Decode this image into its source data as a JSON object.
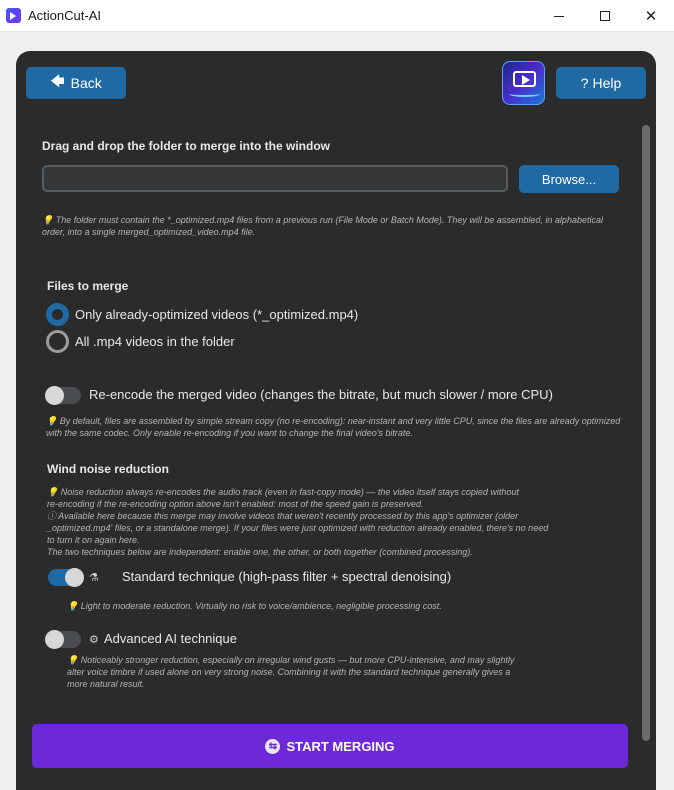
{
  "window": {
    "title": "ActionCut-AI",
    "minimize": "–",
    "maximize": "□",
    "close": "✕"
  },
  "header": {
    "back_label": "Back",
    "help_label": "Help",
    "back_icon": "arrow-left-icon",
    "help_icon": "question-icon"
  },
  "source": {
    "heading": "Drag and drop the folder to merge into the window",
    "path_value": "",
    "browse_label": "Browse...",
    "hint": "💡 The folder must contain the *_optimized.mp4 files from a previous run (File Mode or Batch Mode). They will be assembled, in alphabetical order, into a single merged_optimized_video.mp4 file."
  },
  "files": {
    "heading": "Files to merge",
    "options": [
      {
        "label": "Only already-optimized videos (*_optimized.mp4)",
        "selected": true
      },
      {
        "label": "All .mp4 videos in the folder",
        "selected": false
      }
    ]
  },
  "reencode": {
    "label": "Re-encode the merged video (changes the bitrate, but much slower / more CPU)",
    "enabled": false,
    "hint": "💡 By default, files are assembled by simple stream copy (no re-encoding): near-instant and very little CPU, since the files are already optimized with the same codec. Only enable re-encoding if you want to change the final video's bitrate."
  },
  "wind": {
    "heading": "Wind noise reduction",
    "hint_lines": [
      "💡 Noise reduction always re-encodes the audio track (even in fast-copy mode) — the video itself stays copied without",
      "re-encoding if the re-encoding option above isn't enabled: most of the speed gain is preserved.",
      "ⓘ Available here because this merge may involve videos that weren't recently processed by this app's optimizer (older",
      "_optimized.mp4' files, or a standalone merge). If your files were just optimized with reduction already enabled, there's no need",
      "to turn it on again here.",
      "The two techniques below are independent: enable one, the other, or both together (combined processing)."
    ],
    "standard": {
      "label": "Standard technique (high-pass filter + spectral denoising)",
      "enabled": true,
      "icon": "filter-icon",
      "hint": "💡 Light to moderate reduction. Virtually no risk to voice/ambience, negligible processing cost."
    },
    "advanced": {
      "label": "Advanced AI technique",
      "enabled": false,
      "icon": "brain-icon",
      "hint_lines": [
        "💡 Noticeably stronger reduction, especially on irregular wind gusts — but more CPU-intensive, and may slightly",
        "alter voice timbre if used alone on very strong noise. Combining it with the standard technique generally gives a",
        "more natural result."
      ]
    }
  },
  "action": {
    "start_label": "START MERGING",
    "icon": "merge-icon"
  },
  "colors": {
    "accent": "#1f6aa5",
    "start": "#6d28d9",
    "panel": "#2b2b2b"
  }
}
